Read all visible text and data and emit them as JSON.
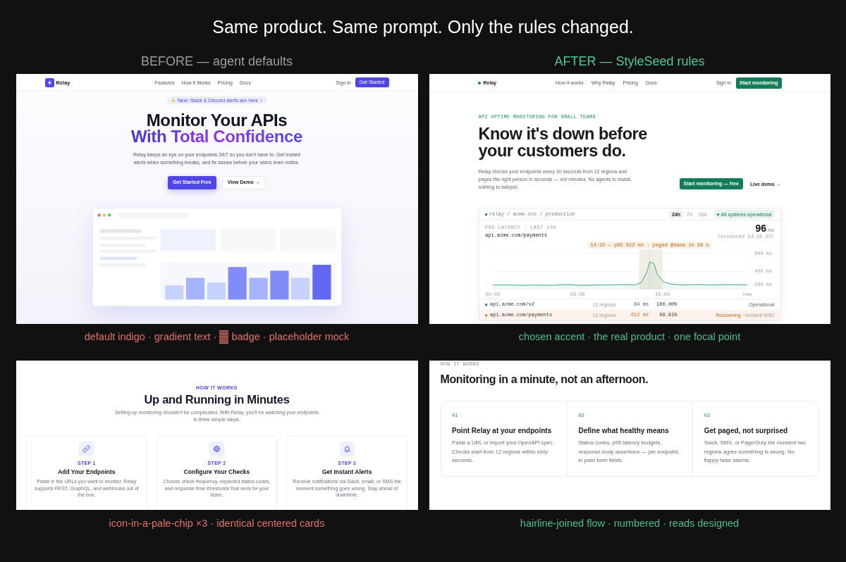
{
  "title": "Same product. Same prompt. Only the rules changed.",
  "before": {
    "heading": "BEFORE — agent defaults",
    "hero_screen": {
      "nav": {
        "brand": "Relay",
        "links": [
          "Features",
          "How it Works",
          "Pricing",
          "Docs"
        ],
        "sign_in": "Sign in",
        "cta": "Get Started"
      },
      "announcement": "New: Slack & Discord alerts are here",
      "headline": "Monitor Your APIs",
      "headline_highlight": "With Total Confidence",
      "description": "Relay keeps an eye on your endpoints 24/7 so you don't have to. Get instant alerts when something breaks, and fix issues before your users even notice.",
      "primary_button": "Get Started Free",
      "secondary_button": "View Demo →"
    },
    "hero_caption": {
      "text_before_icon": "default indigo · gradient text ·",
      "text_after_icon": "badge · placeholder mock"
    },
    "steps_screen": {
      "eyebrow": "HOW IT WORKS",
      "heading": "Up and Running in Minutes",
      "description": "Setting up monitoring shouldn't be complicated. With Relay, you'll be watching your endpoints in three simple steps.",
      "steps": [
        {
          "label": "STEP 1",
          "title": "Add Your Endpoints",
          "description": "Paste in the URLs you want to monitor. Relay supports REST, GraphQL, and webhooks out of the box."
        },
        {
          "label": "STEP 2",
          "title": "Configure Your Checks",
          "description": "Choose check frequency, expected status codes, and response time thresholds that work for your team."
        },
        {
          "label": "STEP 3",
          "title": "Get Instant Alerts",
          "description": "Receive notifications via Slack, email, or SMS the moment something goes wrong. Stay ahead of downtime."
        }
      ]
    },
    "steps_caption": "icon-in-a-pale-chip ×3 · identical centered cards"
  },
  "after": {
    "heading": "AFTER — StyleSeed rules",
    "hero_screen": {
      "nav": {
        "brand": "Relay",
        "links": [
          "How it works",
          "Why Relay",
          "Pricing",
          "Docs"
        ],
        "sign_in": "Sign in",
        "cta": "Start monitoring"
      },
      "eyebrow": "API UPTIME MONITORING FOR SMALL TEAMS",
      "headline": "Know it's down before your customers do.",
      "description": "Relay checks your endpoints every 30 seconds from 12 regions and pages the right person in seconds — not minutes. No agents to install, nothing to babysit.",
      "primary_button": "Start monitoring — free",
      "secondary_button": "Live demo →",
      "dashboard": {
        "breadcrumb": "relay / acme-inc / production",
        "ranges": [
          {
            "label": "24h",
            "selected": true
          },
          {
            "label": "7d",
            "selected": false
          },
          {
            "label": "30d",
            "selected": false
          }
        ],
        "status_badge": "All systems operational",
        "metric_label": "P95 LATENCY · LAST 24H",
        "endpoint": "api.acme.com/payments",
        "metric_value": "96",
        "metric_unit": "ms",
        "metric_note": "recovered 14:38 UTC",
        "chart_data": {
          "type": "area",
          "x": [
            0,
            1.5,
            2.8,
            4,
            5.5,
            6.9,
            8.3,
            9.8,
            11.1,
            12.3,
            13.4,
            14,
            14.5,
            14.8,
            15.2,
            15.5,
            16.1,
            16.8,
            18.1,
            19.4,
            20.9,
            22.2,
            24
          ],
          "series": [
            {
              "color": "#2f9e74",
              "values": [
                100,
                100,
                90,
                100,
                90,
                110,
                90,
                100,
                100,
                110,
                100,
                160,
                370,
                612,
                580,
                340,
                170,
                120,
                100,
                110,
                100,
                110,
                100
              ]
            }
          ],
          "xlim": [
            0,
            24
          ],
          "ylim": [
            0,
            880
          ],
          "xticks": [
            {
              "value": 0,
              "label": "00:00"
            },
            {
              "value": 8,
              "label": "08:00"
            },
            {
              "value": 16,
              "label": "16:00"
            },
            {
              "value": 24,
              "label": "now"
            }
          ],
          "yticks": [
            {
              "value": 100,
              "label": "100 ms"
            },
            {
              "value": 400,
              "label": "400 ms"
            },
            {
              "value": 800,
              "label": "800 ms"
            }
          ],
          "bands": [
            {
              "axis": "x",
              "from": 13.8,
              "to": 16
            }
          ],
          "ref_lines": [
            {
              "axis": "x",
              "value": 14.8
            }
          ],
          "annotations": [
            "14:32 — p95 612 ms · paged @dana in 38 s"
          ]
        },
        "endpoints": [
          {
            "kind": "operational",
            "color": "#17805a",
            "name": "api.acme.com/v2",
            "regions": "12 regions",
            "latency": "84 ms",
            "uptime": "100.00%",
            "status": "Operational"
          },
          {
            "kind": "incident",
            "color": "#d97a2b",
            "name": "api.acme.com/payments",
            "regions": "12 regions",
            "latency": "612 ms",
            "uptime": "99.91%",
            "status": "Recovering",
            "status_note": "· incident #482"
          }
        ]
      }
    },
    "hero_caption": "chosen accent · the real product · one focal point",
    "steps_screen": {
      "eyebrow": "HOW IT WORKS",
      "heading": "Monitoring in a minute, not an afternoon.",
      "steps": [
        {
          "number": "01",
          "title": "Point Relay at your endpoints",
          "description": "Paste a URL or import your OpenAPI spec. Checks start from 12 regions within sixty seconds."
        },
        {
          "number": "02",
          "title": "Define what healthy means",
          "description": "Status codes, p95 latency budgets, response-body assertions — per endpoint, in plain form fields."
        },
        {
          "number": "03",
          "title": "Get paged, not surprised",
          "description": "Slack, SMS, or PagerDuty the moment two regions agree something is wrong. No flappy false alarms."
        }
      ]
    },
    "steps_caption": "hairline-joined flow · numbered · reads designed"
  }
}
